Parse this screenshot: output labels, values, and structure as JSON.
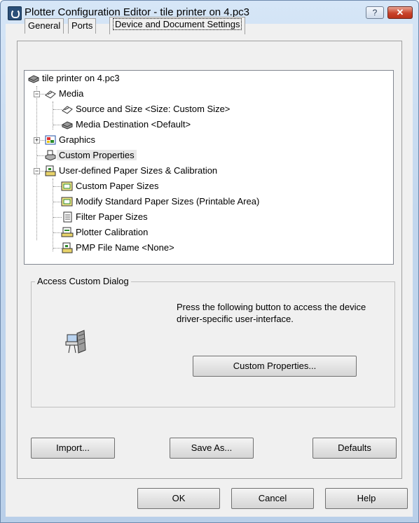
{
  "window": {
    "title": "Plotter Configuration Editor - tile printer on 4.pc3",
    "help_glyph": "?",
    "close_glyph": "✕"
  },
  "tabs": [
    {
      "label": "General"
    },
    {
      "label": "Ports"
    },
    {
      "label": "Device and Document Settings",
      "active": true
    }
  ],
  "tree": {
    "root": "tile printer on 4.pc3",
    "items": [
      {
        "label": "Media",
        "icon": "media-icon"
      },
      {
        "label": "Source and Size <Size: Custom Size>",
        "icon": "source-size-icon"
      },
      {
        "label": "Media Destination <Default>",
        "icon": "media-destination-icon"
      },
      {
        "label": "Graphics",
        "icon": "graphics-icon"
      },
      {
        "label": "Custom Properties",
        "icon": "custom-properties-icon",
        "selected": true
      },
      {
        "label": "User-defined Paper Sizes & Calibration",
        "icon": "paper-calibration-icon"
      },
      {
        "label": "Custom Paper Sizes",
        "icon": "paper-size-icon"
      },
      {
        "label": "Modify Standard Paper Sizes (Printable Area)",
        "icon": "paper-size-icon"
      },
      {
        "label": "Filter Paper Sizes",
        "icon": "document-icon"
      },
      {
        "label": "Plotter Calibration",
        "icon": "calibration-icon"
      },
      {
        "label": "PMP File Name <None>",
        "icon": "pmp-file-icon"
      }
    ]
  },
  "access_group": {
    "title": "Access Custom Dialog",
    "description": "Press the following button to access the device driver-specific user-interface.",
    "custom_properties_button": "Custom Properties..."
  },
  "actions": {
    "import": "Import...",
    "save_as": "Save As...",
    "defaults": "Defaults"
  },
  "footer": {
    "ok": "OK",
    "cancel": "Cancel",
    "help": "Help"
  }
}
